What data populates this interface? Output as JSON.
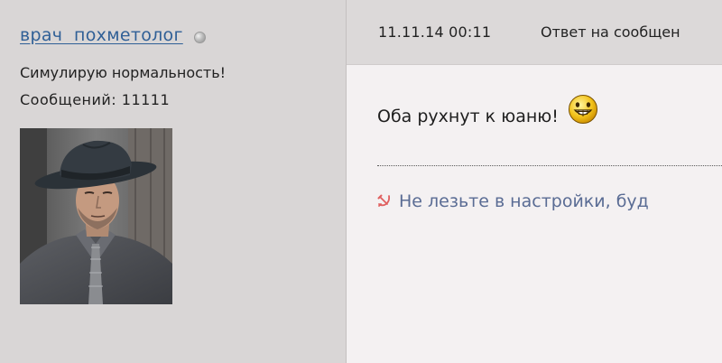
{
  "author": {
    "name": "врач  похметолог",
    "status_text": "Симулирую нормальность!",
    "posts_count": "Сообщений: 11111",
    "online_status_icon": "offline-dot-icon",
    "avatar_description": "photo of a man in a dark fedora hat"
  },
  "post": {
    "date": "11.11.14 00:11",
    "reply_link": "Ответ на сообщен",
    "message": "Оба рухнут к юаню!",
    "message_icon": "grinning-smiley-icon",
    "signature_icon": "hammer-sickle-icon",
    "signature": "Не лезьте в настройки, буд"
  },
  "colors": {
    "link": "#2f5f96",
    "signature_text": "#5a6c94",
    "author_bg": "#d9d6d6",
    "body_bg": "#f4f1f2",
    "sickle": "#e06060"
  }
}
